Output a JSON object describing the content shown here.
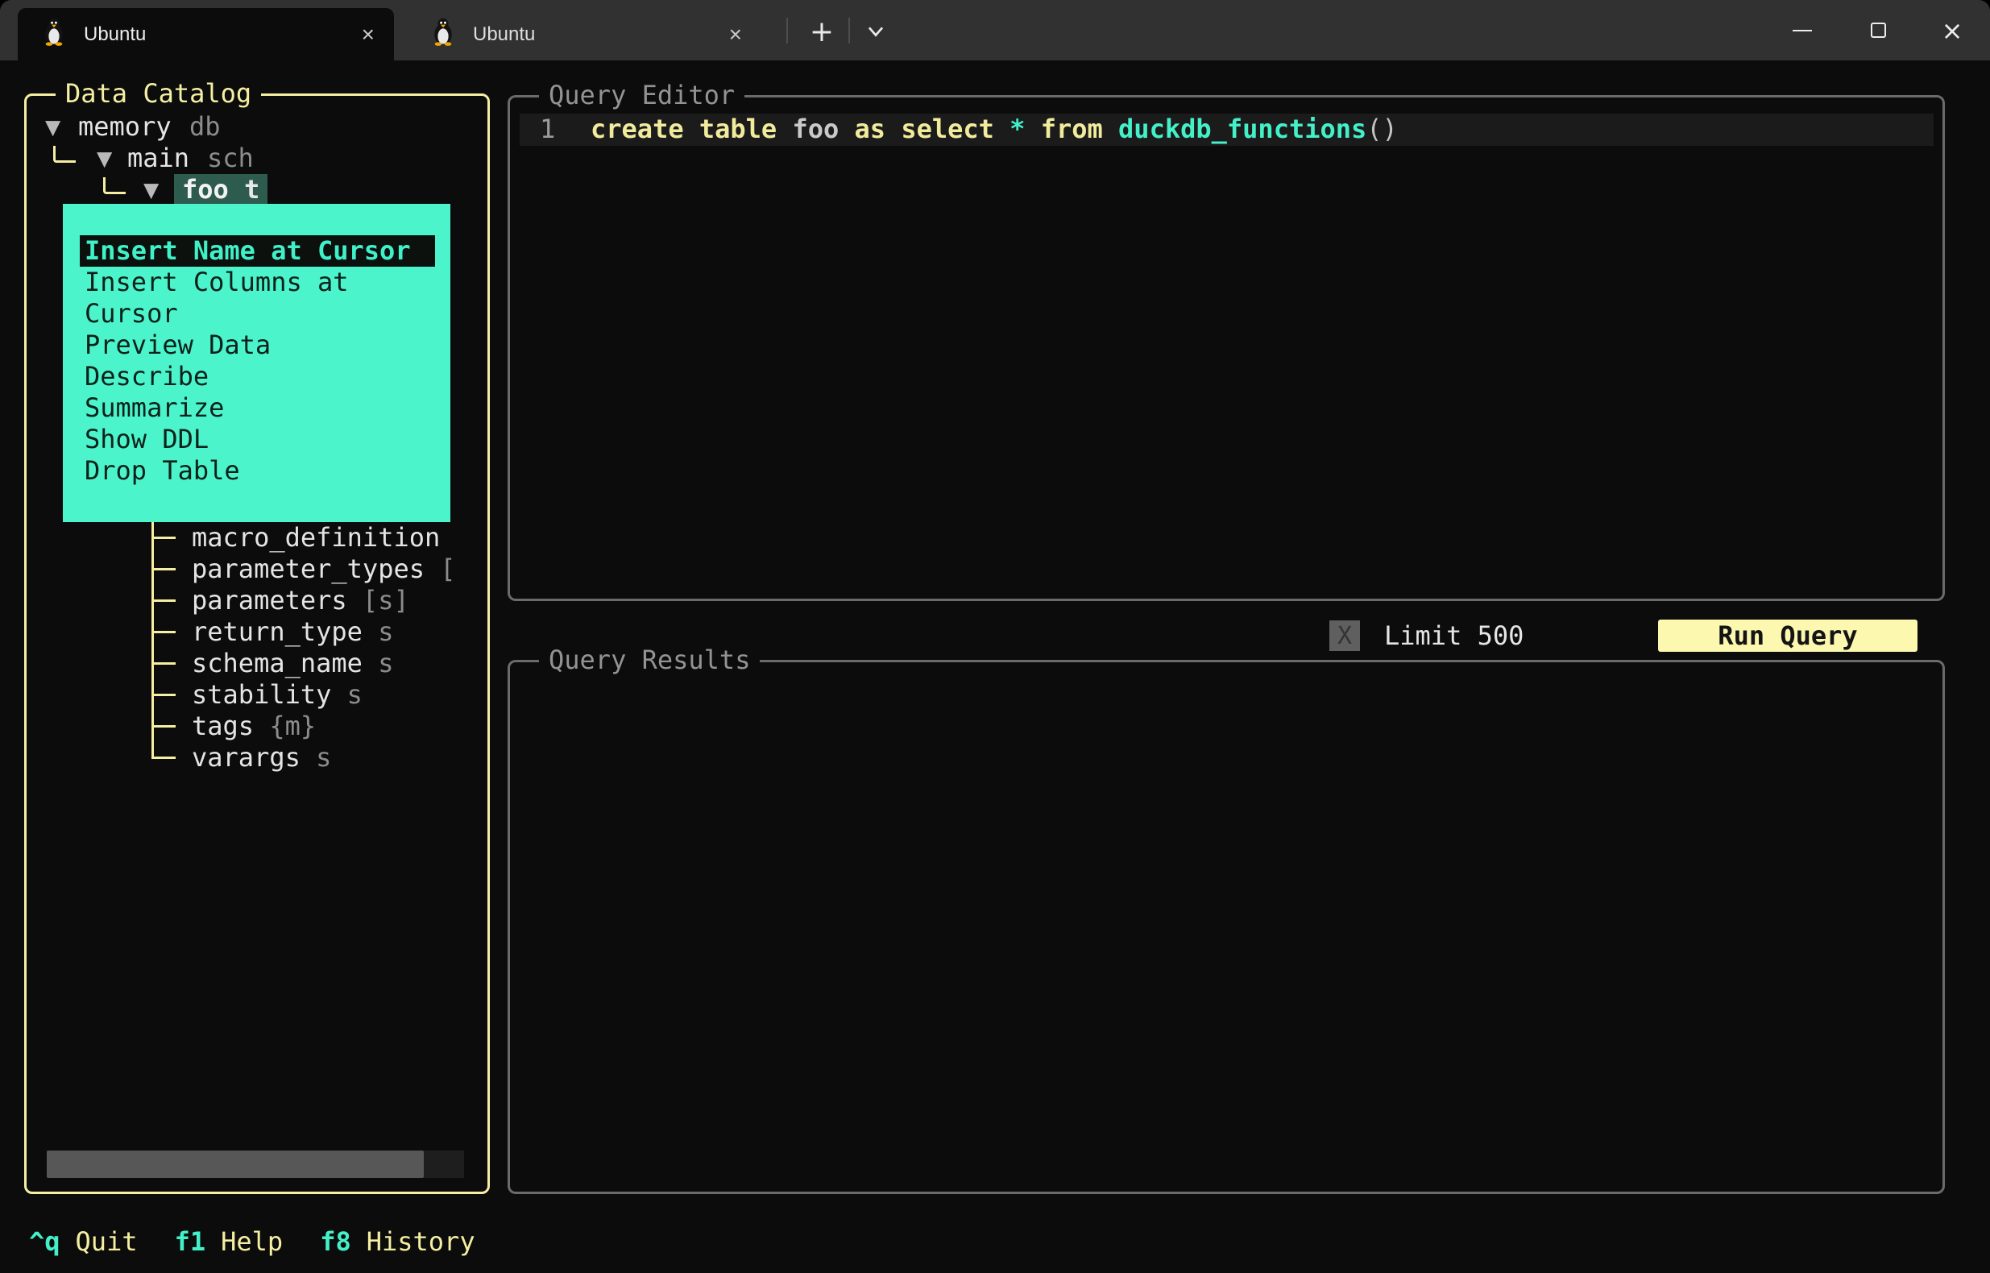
{
  "window": {
    "tabs": [
      {
        "label": "Ubuntu",
        "close": "×",
        "active": true
      },
      {
        "label": "Ubuntu",
        "close": "×",
        "active": false
      }
    ],
    "new_tab_label": "+",
    "controls": {
      "minimize": "─",
      "maximize": "□",
      "close": "×"
    }
  },
  "catalog": {
    "title": "Data Catalog",
    "tree": [
      {
        "arrow": "▼",
        "label": "memory",
        "type": "db"
      },
      {
        "arrow": "▼",
        "label": "main",
        "type": "sch"
      },
      {
        "arrow": "▼",
        "label": "foo",
        "type": "t"
      }
    ],
    "columns": [
      {
        "name": "macro_definition",
        "type": ""
      },
      {
        "name": "parameter_types",
        "type": "["
      },
      {
        "name": "parameters",
        "type": "[s]"
      },
      {
        "name": "return_type",
        "type": "s"
      },
      {
        "name": "schema_name",
        "type": "s"
      },
      {
        "name": "stability",
        "type": "s"
      },
      {
        "name": "tags",
        "type": "{m}"
      },
      {
        "name": "varargs",
        "type": "s"
      }
    ]
  },
  "menu": {
    "selected_index": 0,
    "items": [
      "Insert Name at Cursor",
      "Insert Columns at Cursor",
      "Preview Data",
      "Describe",
      "Summarize",
      "Show DDL",
      "Drop Table"
    ]
  },
  "editor": {
    "title": "Query Editor",
    "line_number": "1",
    "tokens": [
      {
        "text": "create table ",
        "type": "keyword"
      },
      {
        "text": "foo",
        "type": "identifier"
      },
      {
        "text": " as select ",
        "type": "keyword"
      },
      {
        "text": "*",
        "type": "operator"
      },
      {
        "text": " from ",
        "type": "keyword"
      },
      {
        "text": "duckdb_functions",
        "type": "function"
      },
      {
        "text": "()",
        "type": "punctuation"
      }
    ]
  },
  "run_bar": {
    "checkbox": "X",
    "limit_label": "Limit 500",
    "run_button": "Run Query"
  },
  "results": {
    "title": "Query Results"
  },
  "footer": [
    {
      "key": "^q",
      "label": "Quit"
    },
    {
      "key": "f1",
      "label": "Help"
    },
    {
      "key": "f8",
      "label": "History"
    }
  ],
  "colors": {
    "accent_teal": "#43f0c8",
    "accent_yellow": "#f5efa2",
    "menu_background": "#4cf4cc",
    "selection_background": "#2d5c4e",
    "run_button_background": "#fcf8af",
    "terminal_background": "#0c0c0c"
  }
}
